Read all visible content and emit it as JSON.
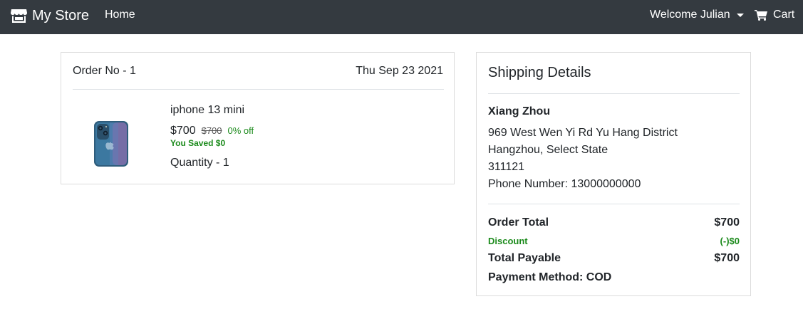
{
  "navbar": {
    "brand": "My Store",
    "home": "Home",
    "welcome": "Welcome Julian",
    "cart": "Cart",
    "bg_color": "#343a40"
  },
  "order": {
    "order_no": "Order No - 1",
    "date": "Thu Sep 23 2021",
    "item": {
      "name": "iphone 13 mini",
      "price": "$700",
      "original_price": "$700",
      "discount_pct": "0% off",
      "saved": "You Saved $0",
      "quantity": "Quantity - 1",
      "image_icon": "phone-image"
    }
  },
  "shipping": {
    "title": "Shipping Details",
    "name": "Xiang Zhou",
    "address_line1": "969 West Wen Yi Rd Yu Hang District",
    "address_line2": "Hangzhou, Select State",
    "postal": "311121",
    "phone": "Phone Number: 13000000000",
    "order_total_label": "Order Total",
    "order_total_value": "$700",
    "discount_label": "Discount",
    "discount_value": "(-)$0",
    "payable_label": "Total Payable",
    "payable_value": "$700",
    "payment_method": "Payment Method: COD",
    "green": "#1b8a1b"
  }
}
